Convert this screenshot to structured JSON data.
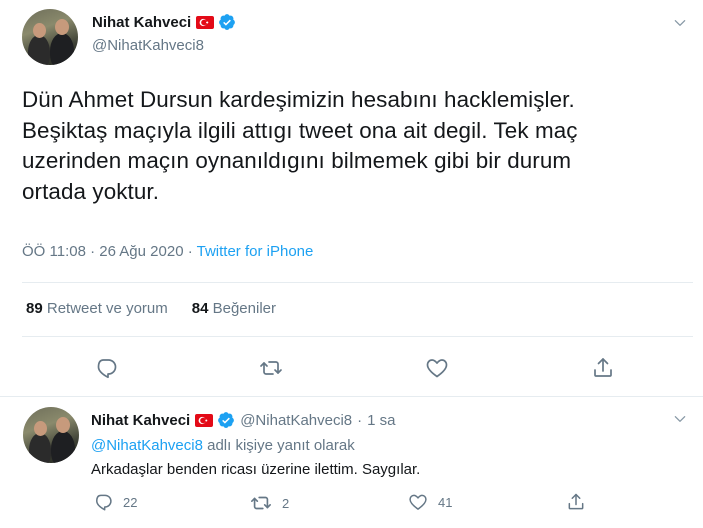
{
  "main_tweet": {
    "display_name": "Nihat Kahveci",
    "handle": "@NihatKahveci8",
    "text_lines": [
      "Dün Ahmet Dursun kardeşimizin hesabını hacklemişler.",
      "Beşiktaş maçıyla ilgili attıgı tweet ona ait degil. Tek maç",
      "uzerinden maçın oynanıldıgını bilmemek gibi bir durum",
      "ortada yoktur."
    ],
    "time": "ÖÖ 11:08",
    "separator": "·",
    "date": "26 Ağu 2020",
    "source": "Twitter for iPhone",
    "retweet_count": "89",
    "retweet_label": "Retweet ve yorum",
    "like_count": "84",
    "like_label": "Beğeniler"
  },
  "reply_tweet": {
    "display_name": "Nihat Kahveci",
    "handle": "@NihatKahveci8",
    "separator": "·",
    "time_ago": "1 sa",
    "reply_mention": "@NihatKahveci8",
    "reply_suffix": " adlı kişiye yanıt olarak",
    "text": "Arkadaşlar benden ricası üzerine ilettim. Saygılar.",
    "reply_count": "22",
    "retweet_count": "2",
    "like_count": "41"
  },
  "icons": {
    "verified": "verified-badge-icon",
    "flag": "turkey-flag-icon",
    "caret": "chevron-down-icon",
    "reply": "reply-icon",
    "retweet": "retweet-icon",
    "like": "heart-icon",
    "share": "share-icon"
  },
  "colors": {
    "text": "#14171a",
    "secondary": "#657786",
    "accent": "#1da1f2",
    "divider": "#e6ecf0",
    "flag": "#e30a17"
  }
}
